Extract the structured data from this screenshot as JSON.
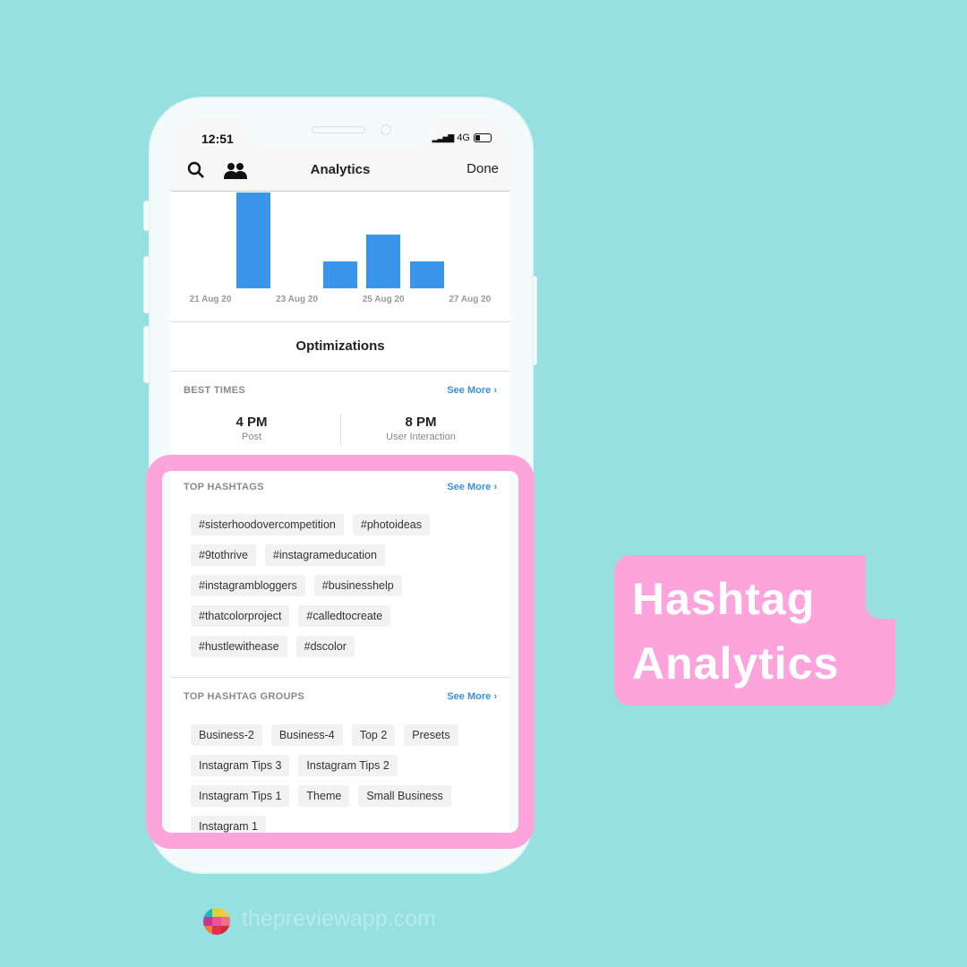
{
  "status": {
    "time": "12:51",
    "network": "4G"
  },
  "header": {
    "title": "Analytics",
    "done_label": "Done",
    "icons": [
      "search-icon",
      "people-icon"
    ]
  },
  "chart_data": {
    "type": "bar",
    "categories": [
      "21 Aug 20",
      "22 Aug 20",
      "23 Aug 20",
      "24 Aug 20",
      "25 Aug 20",
      "26 Aug 20",
      "27 Aug 20"
    ],
    "values": [
      0,
      4,
      0,
      1,
      2,
      1,
      0
    ],
    "tick_labels": [
      "21 Aug 20",
      "23 Aug 20",
      "25 Aug 20",
      "27 Aug 20"
    ],
    "color": "#3a96ea"
  },
  "optimizations": {
    "title": "Optimizations",
    "best_times": {
      "label": "BEST TIMES",
      "see_more": "See More",
      "post_time": "4 PM",
      "post_label": "Post",
      "interaction_time": "8 PM",
      "interaction_label": "User Interaction"
    },
    "top_hashtags": {
      "label": "TOP HASHTAGS",
      "see_more": "See More",
      "tags": [
        "#sisterhoodovercompetition",
        "#photoideas",
        "#9tothrive",
        "#instagrameducation",
        "#instagrambloggers",
        "#businesshelp",
        "#thatcolorproject",
        "#calledtocreate",
        "#hustlewithease",
        "#dscolor"
      ]
    },
    "top_groups": {
      "label": "TOP HASHTAG GROUPS",
      "see_more": "See More",
      "groups": [
        "Business-2",
        "Business-4",
        "Top 2",
        "Presets",
        "Instagram Tips 3",
        "Instagram Tips 2",
        "Instagram Tips 1",
        "Theme",
        "Small Business",
        "Instagram 1"
      ]
    }
  },
  "callout": {
    "line1": "Hashtag",
    "line2": "Analytics"
  },
  "footer": {
    "site": "thepreviewapp.com"
  },
  "colors": {
    "background": "#96e0e2",
    "highlight": "#fda4dc",
    "accent": "#3a8fdc"
  }
}
